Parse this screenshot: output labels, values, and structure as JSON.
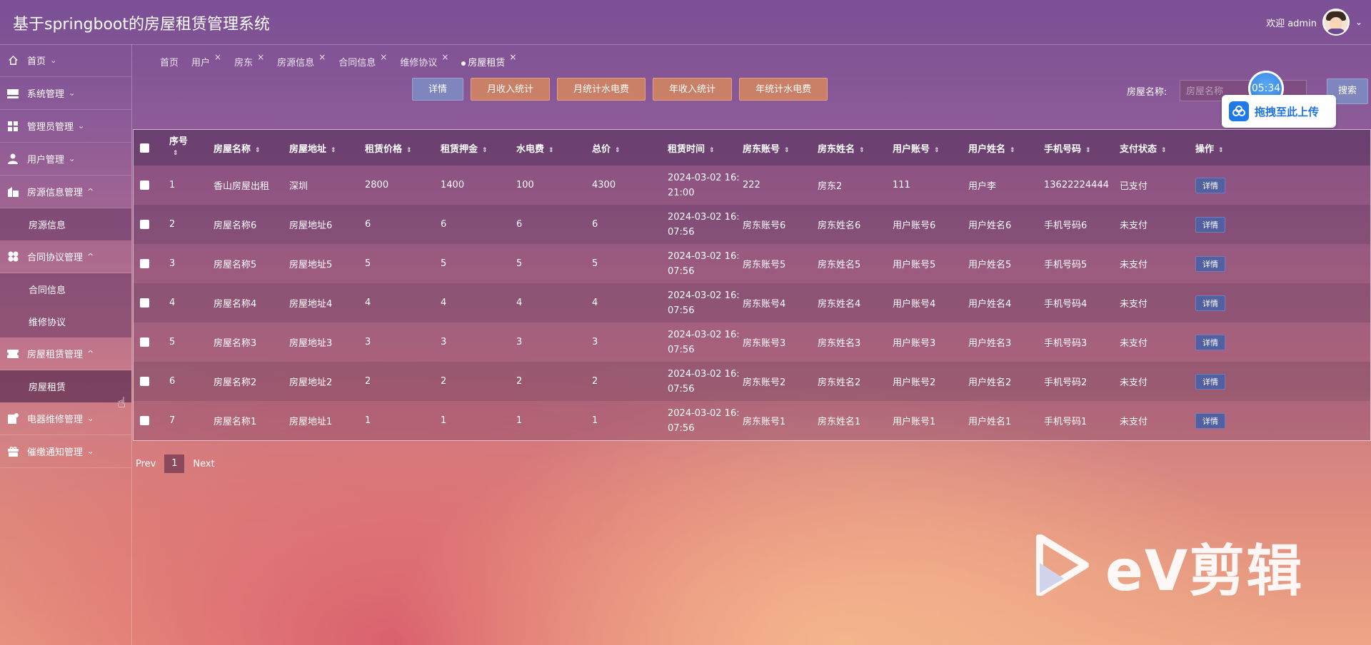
{
  "header": {
    "title": "基于springboot的房屋租赁管理系统",
    "welcome": "欢迎 admin"
  },
  "sidebar": {
    "items": [
      {
        "label": "首页",
        "icon": "home-icon",
        "arrow": "⌄"
      },
      {
        "label": "系统管理",
        "icon": "system-icon",
        "arrow": "⌄"
      },
      {
        "label": "管理员管理",
        "icon": "grid-icon",
        "arrow": "⌄"
      },
      {
        "label": "用户管理",
        "icon": "user-icon",
        "arrow": "⌄"
      },
      {
        "label": "房源信息管理",
        "icon": "building-icon",
        "arrow": "^"
      },
      {
        "label": "合同协议管理",
        "icon": "clover-icon",
        "arrow": "^"
      },
      {
        "label": "房屋租赁管理",
        "icon": "ticket-icon",
        "arrow": "^"
      },
      {
        "label": "电器维修管理",
        "icon": "repair-icon",
        "arrow": "⌄"
      },
      {
        "label": "催缴通知管理",
        "icon": "gift-icon",
        "arrow": "⌄"
      }
    ],
    "subitems": {
      "house_info": "房源信息",
      "contract": "合同信息",
      "repair": "维修协议",
      "rental": "房屋租赁"
    }
  },
  "tabs": [
    {
      "label": "首页",
      "closable": ""
    },
    {
      "label": "用户",
      "closable": "×"
    },
    {
      "label": "房东",
      "closable": "×"
    },
    {
      "label": "房源信息",
      "closable": "×"
    },
    {
      "label": "合同信息",
      "closable": "×"
    },
    {
      "label": "维修协议",
      "closable": "×"
    },
    {
      "label": "房屋租赁",
      "closable": "×"
    }
  ],
  "toolbar": {
    "detail": "详情",
    "month_income": "月收入统计",
    "month_utility": "月统计水电费",
    "year_income": "年收入统计",
    "year_utility": "年统计水电费",
    "search_label": "房屋名称:",
    "search_placeholder": "房屋名称",
    "search_button": "搜索"
  },
  "overlay": {
    "timer": "05:34",
    "upload": "拖拽至此上传"
  },
  "table": {
    "columns": [
      "序号",
      "房屋名称",
      "房屋地址",
      "租赁价格",
      "租赁押金",
      "水电费",
      "总价",
      "租赁时间",
      "房东账号",
      "房东姓名",
      "用户账号",
      "用户姓名",
      "手机号码",
      "支付状态",
      "操作"
    ],
    "action_label": "详情",
    "rows": [
      {
        "no": "1",
        "name": "香山房屋出租",
        "addr": "深圳",
        "price": "2800",
        "deposit": "1400",
        "utility": "100",
        "total": "4300",
        "time1": "2024-03-02 16:",
        "time2": "21:00",
        "lacc": "222",
        "lname": "房东2",
        "uacc": "111",
        "uname": "用户李",
        "phone": "13622224444",
        "status": "已支付"
      },
      {
        "no": "2",
        "name": "房屋名称6",
        "addr": "房屋地址6",
        "price": "6",
        "deposit": "6",
        "utility": "6",
        "total": "6",
        "time1": "2024-03-02 16:",
        "time2": "07:56",
        "lacc": "房东账号6",
        "lname": "房东姓名6",
        "uacc": "用户账号6",
        "uname": "用户姓名6",
        "phone": "手机号码6",
        "status": "未支付"
      },
      {
        "no": "3",
        "name": "房屋名称5",
        "addr": "房屋地址5",
        "price": "5",
        "deposit": "5",
        "utility": "5",
        "total": "5",
        "time1": "2024-03-02 16:",
        "time2": "07:56",
        "lacc": "房东账号5",
        "lname": "房东姓名5",
        "uacc": "用户账号5",
        "uname": "用户姓名5",
        "phone": "手机号码5",
        "status": "未支付"
      },
      {
        "no": "4",
        "name": "房屋名称4",
        "addr": "房屋地址4",
        "price": "4",
        "deposit": "4",
        "utility": "4",
        "total": "4",
        "time1": "2024-03-02 16:",
        "time2": "07:56",
        "lacc": "房东账号4",
        "lname": "房东姓名4",
        "uacc": "用户账号4",
        "uname": "用户姓名4",
        "phone": "手机号码4",
        "status": "未支付"
      },
      {
        "no": "5",
        "name": "房屋名称3",
        "addr": "房屋地址3",
        "price": "3",
        "deposit": "3",
        "utility": "3",
        "total": "3",
        "time1": "2024-03-02 16:",
        "time2": "07:56",
        "lacc": "房东账号3",
        "lname": "房东姓名3",
        "uacc": "用户账号3",
        "uname": "用户姓名3",
        "phone": "手机号码3",
        "status": "未支付"
      },
      {
        "no": "6",
        "name": "房屋名称2",
        "addr": "房屋地址2",
        "price": "2",
        "deposit": "2",
        "utility": "2",
        "total": "2",
        "time1": "2024-03-02 16:",
        "time2": "07:56",
        "lacc": "房东账号2",
        "lname": "房东姓名2",
        "uacc": "用户账号2",
        "uname": "用户姓名2",
        "phone": "手机号码2",
        "status": "未支付"
      },
      {
        "no": "7",
        "name": "房屋名称1",
        "addr": "房屋地址1",
        "price": "1",
        "deposit": "1",
        "utility": "1",
        "total": "1",
        "time1": "2024-03-02 16:",
        "time2": "07:56",
        "lacc": "房东账号1",
        "lname": "房东姓名1",
        "uacc": "用户账号1",
        "uname": "用户姓名1",
        "phone": "手机号码1",
        "status": "未支付"
      }
    ]
  },
  "pager": {
    "prev": "Prev",
    "current": "1",
    "next": "Next"
  },
  "watermark": {
    "text": "eV剪辑"
  }
}
